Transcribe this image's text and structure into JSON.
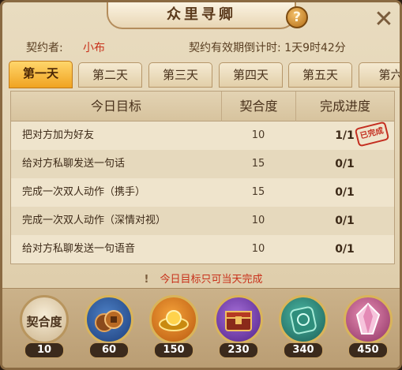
{
  "header": {
    "title": "众里寻卿",
    "help_icon": "?",
    "close_icon": "✕"
  },
  "contract": {
    "owner_label": "契约者:",
    "owner_name": "小布",
    "countdown": "契约有效期倒计时: 1天9时42分"
  },
  "tabs": [
    {
      "label": "第一天",
      "active": true
    },
    {
      "label": "第二天",
      "active": false
    },
    {
      "label": "第三天",
      "active": false
    },
    {
      "label": "第四天",
      "active": false
    },
    {
      "label": "第五天",
      "active": false
    },
    {
      "label": "第六",
      "active": false
    }
  ],
  "table": {
    "headers": [
      "今日目标",
      "契合度",
      "完成进度"
    ],
    "rows": [
      {
        "goal": "把对方加为好友",
        "points": "10",
        "progress": "1/1",
        "completed": true
      },
      {
        "goal": "给对方私聊发送一句话",
        "points": "15",
        "progress": "0/1",
        "completed": false
      },
      {
        "goal": "完成一次双人动作（携手）",
        "points": "15",
        "progress": "0/1",
        "completed": false
      },
      {
        "goal": "完成一次双人动作（深情对视）",
        "points": "10",
        "progress": "0/1",
        "completed": false
      },
      {
        "goal": "给对方私聊发送一句语音",
        "points": "10",
        "progress": "0/1",
        "completed": false
      }
    ],
    "completed_stamp": "已完成"
  },
  "notice": {
    "bang": "!",
    "text": "今日目标只可当天完成"
  },
  "rewards": {
    "base_label": "契合度",
    "base_value": "10",
    "tiers": [
      {
        "value": "60",
        "icon": "coins-icon"
      },
      {
        "value": "150",
        "icon": "gold-ingot-icon"
      },
      {
        "value": "230",
        "icon": "treasure-chest-icon"
      },
      {
        "value": "340",
        "icon": "jade-plaque-icon"
      },
      {
        "value": "450",
        "icon": "crystal-icon"
      }
    ]
  },
  "colors": {
    "accent": "#f0a321",
    "highlight_red": "#c8311b",
    "panel": "#e9dcc0"
  }
}
